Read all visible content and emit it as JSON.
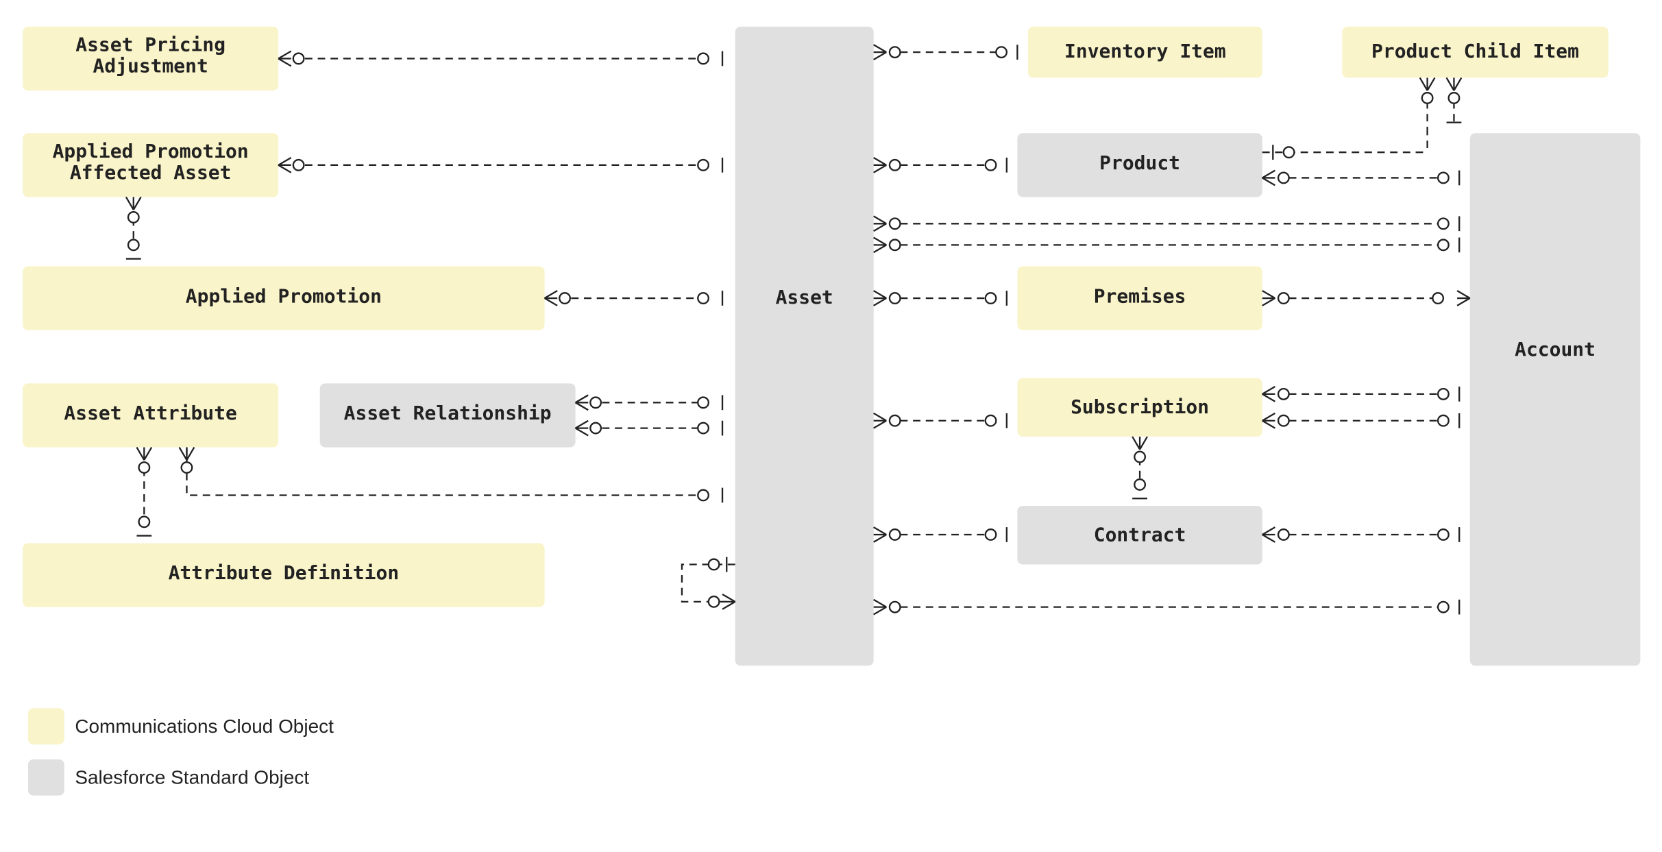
{
  "nodes": {
    "asset_pricing_adjustment": {
      "label": "Asset Pricing\nAdjustment",
      "type": "comm"
    },
    "applied_promotion_affected_asset": {
      "label": "Applied Promotion\nAffected Asset",
      "type": "comm"
    },
    "applied_promotion": {
      "label": "Applied Promotion",
      "type": "comm"
    },
    "asset_attribute": {
      "label": "Asset Attribute",
      "type": "comm"
    },
    "asset_relationship": {
      "label": "Asset Relationship",
      "type": "std"
    },
    "attribute_definition": {
      "label": "Attribute Definition",
      "type": "comm"
    },
    "asset": {
      "label": "Asset",
      "type": "std"
    },
    "inventory_item": {
      "label": "Inventory Item",
      "type": "comm"
    },
    "product_child_item": {
      "label": "Product Child Item",
      "type": "comm"
    },
    "product": {
      "label": "Product",
      "type": "std"
    },
    "premises": {
      "label": "Premises",
      "type": "comm"
    },
    "subscription": {
      "label": "Subscription",
      "type": "comm"
    },
    "contract": {
      "label": "Contract",
      "type": "std"
    },
    "account": {
      "label": "Account",
      "type": "std"
    }
  },
  "legend": {
    "comm": "Communications Cloud Object",
    "std": "Salesforce Standard Object"
  },
  "relationships_note": "Dashed connector lines with open-circle / crow's-foot / tick endpoints denote ERD associations between objects."
}
